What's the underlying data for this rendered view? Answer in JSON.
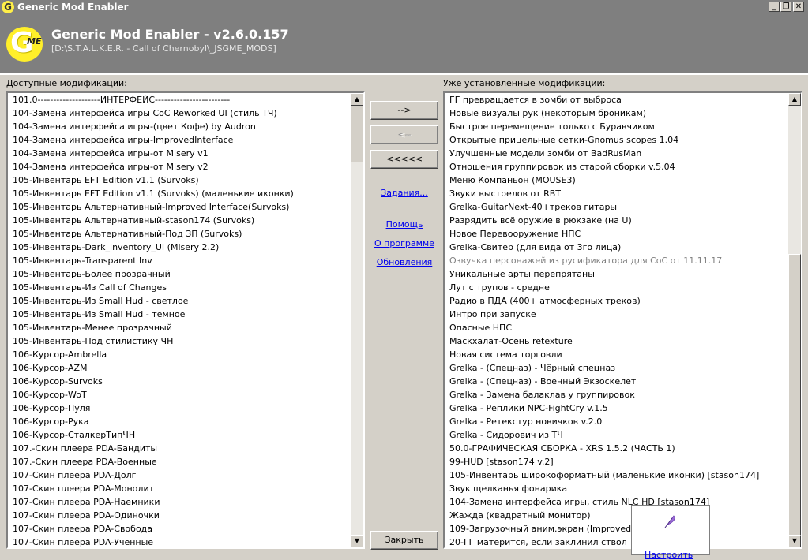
{
  "window": {
    "title": "Generic Mod Enabler",
    "app_icon": "G",
    "buttons": {
      "minimize": "_",
      "restore": "❐",
      "close": "✕"
    }
  },
  "header": {
    "logo_letter": "G",
    "logo_badge": "ME",
    "title": "Generic Mod Enabler - v2.6.0.157",
    "path": "[D:\\S.T.A.L.K.E.R. - Call of Chernobyl\\_JSGME_MODS]"
  },
  "available": {
    "label": "Доступные модификации:",
    "items": [
      "101.0--------------------ИНТЕРФЕЙС------------------------",
      "104-Замена интерфейса игры CoC Reworked UI (стиль ТЧ)",
      "104-Замена интерфейса игры-(цвет Кофе) by Audron",
      "104-Замена интерфейса игры-ImprovedInterface",
      "104-Замена интерфейса игры-от Misery v1",
      "104-Замена интерфейса игры-от Misery v2",
      "105-Инвентарь EFT Edition v1.1 (Survoks)",
      "105-Инвентарь EFT Edition v1.1 (Survoks) (маленькие иконки)",
      "105-Инвентарь Альтернативный-Improved Interface(Survoks)",
      "105-Инвентарь Альтернативный-stason174 (Survoks)",
      "105-Инвентарь Альтернативный-Под ЗП (Survoks)",
      "105-Инвентарь-Dark_inventory_UI (Misery 2.2)",
      "105-Инвентарь-Transparent Inv",
      "105-Инвентарь-Более прозрачный",
      "105-Инвентарь-Из Call of Changes",
      "105-Инвентарь-Из Small Hud - светлое",
      "105-Инвентарь-Из Small Hud - темное",
      "105-Инвентарь-Менее прозрачный",
      "105-Инвентарь-Под стилистику ЧН",
      "106-Курсор-Ambrella",
      "106-Курсор-AZM",
      "106-Курсор-Survoks",
      "106-Курсор-WoT",
      "106-Курсор-Пуля",
      "106-Курсор-Рука",
      "106-Курсор-СталкерТипЧН",
      "107.-Скин плеера PDA-Бандиты",
      "107.-Скин плеера PDA-Военные",
      "107-Скин плеера PDA-Долг",
      "107-Скин плеера PDA-Монолит",
      "107-Скин плеера PDA-Наемники",
      "107-Скин плеера PDA-Одиночки",
      "107-Скин плеера PDA-Свобода",
      "107-Скин плеера PDA-Ученные"
    ]
  },
  "installed": {
    "label": "Уже установленные модификации:",
    "items": [
      "ГГ превращается в зомби от выброса",
      "Новые визуалы рук (некоторым броникам)",
      "Быстрое перемещение только с Буравчиком",
      "Открытые прицельные сетки-Gnomus scopes 1.04",
      "Улучшенные модели зомби от BadRusMan",
      "Отношения группировок из старой сборки v.5.04",
      "Меню Компаньон (MOUSE3)",
      "Звуки выстрелов от RBT",
      "Grelka-GuitarNext-40+треков гитары",
      "Разрядить всё оружие в рюкзаке (на U)",
      "Новое Перевооружение НПС",
      "Grelka-Свитер (для вида от 3го лица)",
      "Озвучка персонажей из русификатора для CoC от 11.11.17",
      "Уникальные арты перепрятаны",
      "Лут с трупов - средне",
      "Радио в ПДА (400+ атмосферных треков)",
      "Интро при запуске",
      "Опасные НПС",
      "Маскхалат-Осень retexture",
      "Новая система торговли",
      "Grelka - (Спецназ) - Чёрный спецназ",
      "Grelka - (Спецназ) - Военный Экзоскелет",
      "Grelka - Замена балаклав у группировок",
      "Grelka - Реплики NPC-FightCry v.1.5",
      "Grelka - Ретекстур новичков v.2.0",
      "Grelka - Сидорович из ТЧ",
      "50.0-ГРАФИЧЕСКАЯ СБОРКА - XRS 1.5.2 (ЧАСТЬ 1)",
      "99-HUD [stason174 v.2]",
      "105-Инвентарь широкоформатный (маленькие иконки) [stason174]",
      "Звук щелканья фонарика",
      "104-Замена интерфейса игры, стиль NLC HD [stason174]",
      "Жажда (квадратный монитор)",
      "109-Загрузочный аним.экран (ImprovedInterfa",
      "20-ГГ матерится, если заклинил ствол"
    ],
    "dim_index": 12
  },
  "actions": {
    "activate": "-->",
    "deactivate": "<--",
    "deactivate_all": "<<<<<",
    "tasks": "Задания...",
    "help": "Помощь",
    "about": "О программе",
    "updates": "Обновления",
    "close": "Закрыть"
  },
  "popup": {
    "label": "Настроить",
    "icon": "feather-icon"
  },
  "colors": {
    "header_bg": "#7f7f7f",
    "link": "#0000ee",
    "logo_yellow": "#ffef2a"
  }
}
